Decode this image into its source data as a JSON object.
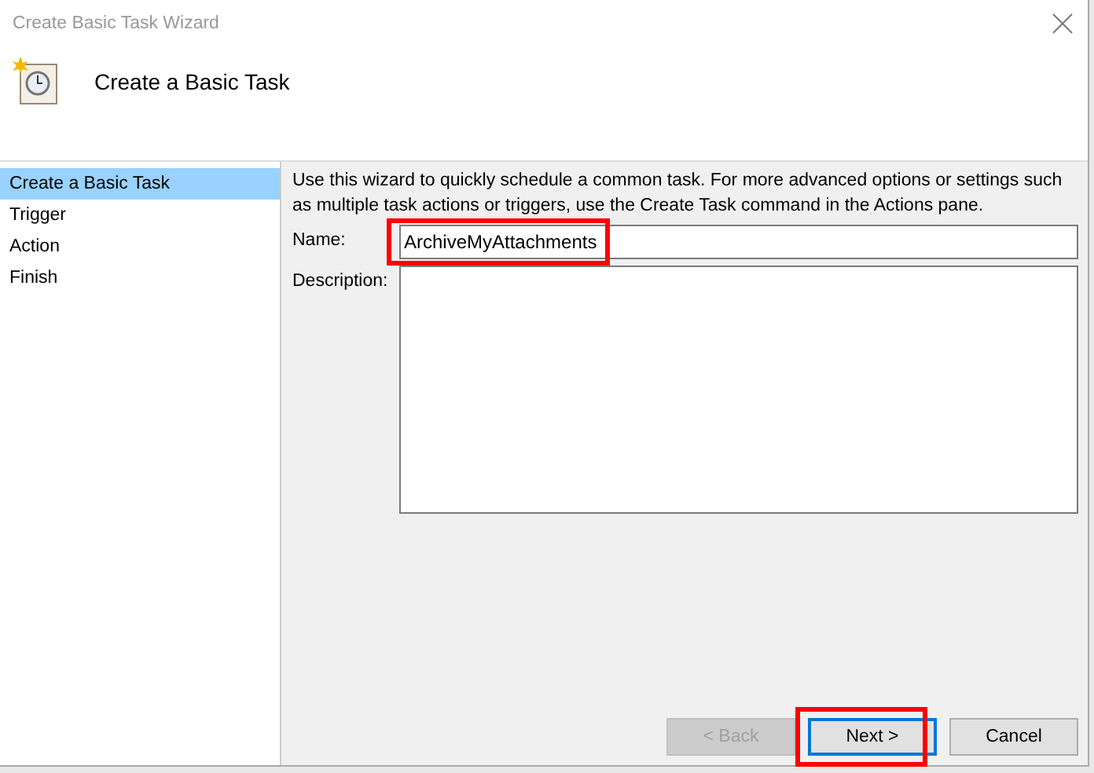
{
  "window": {
    "title": "Create Basic Task Wizard",
    "heading": "Create a Basic Task"
  },
  "sidebar": {
    "items": [
      {
        "label": "Create a Basic Task",
        "selected": true
      },
      {
        "label": "Trigger",
        "selected": false
      },
      {
        "label": "Action",
        "selected": false
      },
      {
        "label": "Finish",
        "selected": false
      }
    ]
  },
  "intro": "Use this wizard to quickly schedule a common task.  For more advanced options or settings such as multiple task actions or triggers, use the Create Task command in the Actions pane.",
  "fields": [
    {
      "label": "Name:",
      "value": "ArchiveMyAttachments",
      "kind": "input",
      "highlighted": true
    },
    {
      "label": "Description:",
      "kind": "textarea",
      "highlighted": false
    }
  ],
  "buttons": [
    {
      "label": "< Back",
      "disabled": true,
      "focused": false,
      "highlighted": false
    },
    {
      "label": "Next >",
      "disabled": false,
      "focused": true,
      "highlighted": true
    },
    {
      "label": "Cancel",
      "disabled": false,
      "focused": false,
      "highlighted": false
    }
  ]
}
